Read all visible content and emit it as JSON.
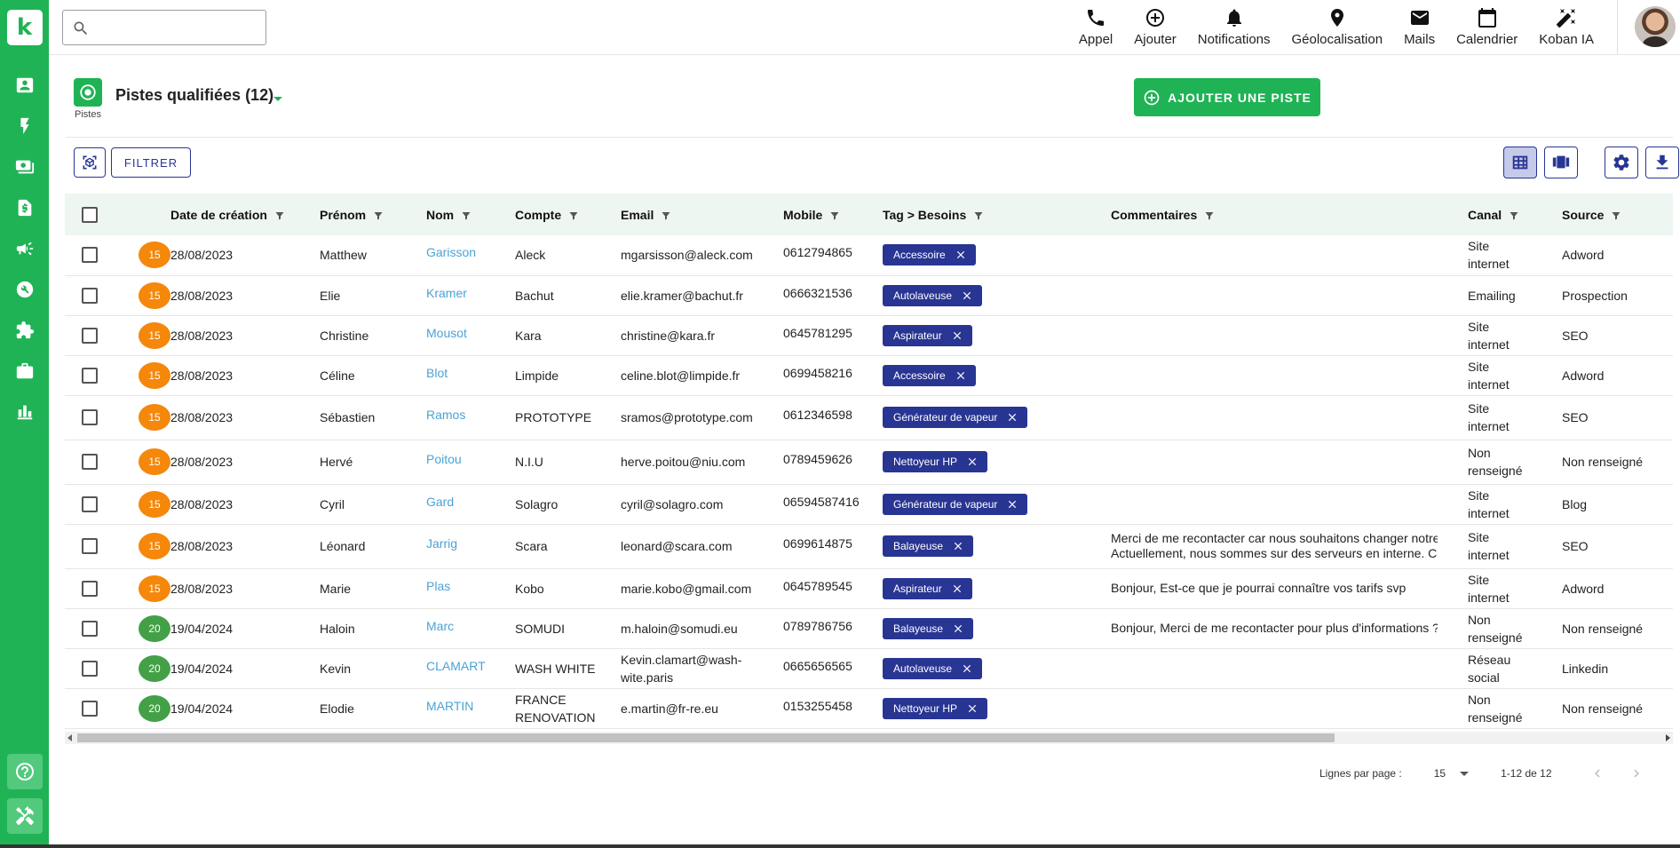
{
  "app": {
    "logo_letter": "k"
  },
  "sidebar": {
    "items": [
      {
        "name": "contacts",
        "icon": "contact-card-icon"
      },
      {
        "name": "leads",
        "icon": "lightning-icon"
      },
      {
        "name": "sales",
        "icon": "money-icon"
      },
      {
        "name": "documents",
        "icon": "invoice-icon"
      },
      {
        "name": "marketing",
        "icon": "megaphone-icon"
      },
      {
        "name": "support",
        "icon": "wrench-icon"
      },
      {
        "name": "extensions",
        "icon": "puzzle-icon"
      },
      {
        "name": "business",
        "icon": "briefcase-icon"
      },
      {
        "name": "reports",
        "icon": "bar-chart-icon"
      }
    ],
    "bottom": [
      {
        "name": "help",
        "icon": "help-icon"
      },
      {
        "name": "tools",
        "icon": "tools-icon"
      }
    ]
  },
  "search": {
    "value": "",
    "placeholder": ""
  },
  "topbar": {
    "actions": [
      {
        "label": "Appel",
        "icon": "phone-icon"
      },
      {
        "label": "Ajouter",
        "icon": "add-circle-icon"
      },
      {
        "label": "Notifications",
        "icon": "bell-icon"
      },
      {
        "label": "Géolocalisation",
        "icon": "location-pin-icon"
      },
      {
        "label": "Mails",
        "icon": "mail-icon"
      },
      {
        "label": "Calendrier",
        "icon": "calendar-icon"
      },
      {
        "label": "Koban IA",
        "icon": "magic-wand-icon"
      }
    ]
  },
  "page": {
    "badge_label": "Pistes",
    "title": "Pistes qualifiées (12)",
    "add_button": "AJOUTER UNE PISTE",
    "filter_button": "FILTRER"
  },
  "colors": {
    "brand": "#1fb355",
    "primary": "#283593",
    "score_orange": "#f5870a",
    "score_green": "#43a047",
    "link": "#4aa3d6"
  },
  "table": {
    "columns": [
      "Date de création",
      "Prénom",
      "Nom",
      "Compte",
      "Email",
      "Mobile",
      "Tag > Besoins",
      "Commentaires",
      "Canal",
      "Source"
    ],
    "rows": [
      {
        "score": "15",
        "score_color": "#f5870a",
        "date": "28/08/2023",
        "prenom": "Matthew",
        "nom": "Garisson",
        "compte": "Aleck",
        "email": "mgarsisson@aleck.com",
        "mobile": "0612794865",
        "tag": "Accessoire",
        "commentaires": "",
        "canal": "Site internet",
        "source": "Adword"
      },
      {
        "score": "15",
        "score_color": "#f5870a",
        "date": "28/08/2023",
        "prenom": "Elie",
        "nom": "Kramer",
        "compte": "Bachut",
        "email": "elie.kramer@bachut.fr",
        "mobile": "0666321536",
        "tag": "Autolaveuse",
        "commentaires": "",
        "canal": "Emailing",
        "source": "Prospection"
      },
      {
        "score": "15",
        "score_color": "#f5870a",
        "date": "28/08/2023",
        "prenom": "Christine",
        "nom": "Mousot",
        "compte": "Kara",
        "email": "christine@kara.fr",
        "mobile": "0645781295",
        "tag": "Aspirateur",
        "commentaires": "",
        "canal": "Site internet",
        "source": "SEO"
      },
      {
        "score": "15",
        "score_color": "#f5870a",
        "date": "28/08/2023",
        "prenom": "Céline",
        "nom": "Blot",
        "compte": "Limpide",
        "email": "celine.blot@limpide.fr",
        "mobile": "0699458216",
        "tag": "Accessoire",
        "commentaires": "",
        "canal": "Site internet",
        "source": "Adword"
      },
      {
        "score": "15",
        "score_color": "#f5870a",
        "date": "28/08/2023",
        "prenom": "Sébastien",
        "nom": "Ramos",
        "compte": "PROTOTYPE",
        "email": "sramos@prototype.com",
        "mobile": "0612346598",
        "tag": "Générateur de vapeur",
        "commentaires": "",
        "canal": "Site internet",
        "source": "SEO"
      },
      {
        "score": "15",
        "score_color": "#f5870a",
        "date": "28/08/2023",
        "prenom": "Hervé",
        "nom": "Poitou",
        "compte": "N.I.U",
        "email": "herve.poitou@niu.com",
        "mobile": "0789459626",
        "tag": "Nettoyeur HP",
        "commentaires": "",
        "canal": "Non renseigné",
        "source": "Non renseigné"
      },
      {
        "score": "15",
        "score_color": "#f5870a",
        "date": "28/08/2023",
        "prenom": "Cyril",
        "nom": "Gard",
        "compte": "Solagro",
        "email": "cyril@solagro.com",
        "mobile": "06594587416",
        "tag": "Générateur de vapeur",
        "commentaires": "",
        "canal": "Site internet",
        "source": "Blog"
      },
      {
        "score": "15",
        "score_color": "#f5870a",
        "date": "28/08/2023",
        "prenom": "Léonard",
        "nom": "Jarrig",
        "compte": "Scara",
        "email": "leonard@scara.com",
        "mobile": "0699614875",
        "tag": "Balayeuse",
        "commentaires": "Merci de me recontacter car nous souhaitons changer notre i\nActuellement, nous sommes sur des serveurs en interne. Ceu",
        "canal": "Site internet",
        "source": "SEO"
      },
      {
        "score": "15",
        "score_color": "#f5870a",
        "date": "28/08/2023",
        "prenom": "Marie",
        "nom": "Plas",
        "compte": "Kobo",
        "email": "marie.kobo@gmail.com",
        "mobile": "0645789545",
        "tag": "Aspirateur",
        "commentaires": "Bonjour, Est-ce que je pourrai connaître vos tarifs svp",
        "canal": "Site internet",
        "source": "Adword"
      },
      {
        "score": "20",
        "score_color": "#43a047",
        "date": "19/04/2024",
        "prenom": "Haloin",
        "nom": "Marc",
        "compte": "SOMUDI",
        "email": "m.haloin@somudi.eu",
        "mobile": "0789786756",
        "tag": "Balayeuse",
        "commentaires": "Bonjour, Merci de me recontacter pour plus d'informations ?",
        "canal": "Non renseigné",
        "source": "Non renseigné"
      },
      {
        "score": "20",
        "score_color": "#43a047",
        "date": "19/04/2024",
        "prenom": "Kevin",
        "nom": "CLAMART",
        "compte": "WASH WHITE",
        "email": "Kevin.clamart@wash-wite.paris",
        "mobile": "0665656565",
        "tag": "Autolaveuse",
        "commentaires": "",
        "canal": "Réseau social",
        "source": "Linkedin"
      },
      {
        "score": "20",
        "score_color": "#43a047",
        "date": "19/04/2024",
        "prenom": "Elodie",
        "nom": "MARTIN",
        "compte": "FRANCE RENOVATION",
        "email": "e.martin@fr-re.eu",
        "mobile": "0153255458",
        "tag": "Nettoyeur HP",
        "commentaires": "",
        "canal": "Non renseigné",
        "source": "Non renseigné"
      }
    ]
  },
  "pagination": {
    "rows_label": "Lignes par page :",
    "rows_value": "15",
    "range": "1-12 de 12"
  }
}
